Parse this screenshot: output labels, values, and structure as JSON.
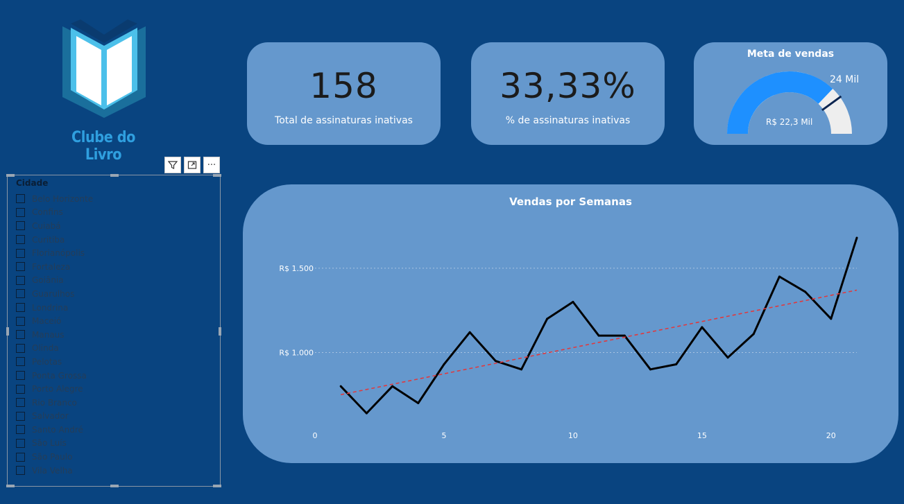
{
  "brand": {
    "name": "Clube do Livro",
    "logo_icon": "open-book-icon",
    "colors": {
      "dark": "#1a6f9c",
      "light": "#4cc0ea",
      "page": "#ffffff"
    }
  },
  "slicer": {
    "title": "Cidade",
    "toolbar": {
      "filter_icon": "filter-icon",
      "focus_icon": "focus-mode-icon",
      "more_icon": "more-options-icon",
      "more_label": "···"
    },
    "items": [
      "Belo Horizonte",
      "Confins",
      "Cuiabá",
      "Curitiba",
      "Florianópolis",
      "Fortaleza",
      "Goiânia",
      "Guarulhos",
      "Londrina",
      "Maceió",
      "Manaus",
      "Olinda",
      "Pelotas",
      "Ponta Grossa",
      "Porto Alegre",
      "Rio Branco",
      "Salvador",
      "Santo André",
      "São Luís",
      "São Paulo",
      "Vila Velha"
    ]
  },
  "kpi_inactive": {
    "value": "158",
    "label": "Total de assinaturas inativas"
  },
  "kpi_pct": {
    "value": "33,33%",
    "label": "% de assinaturas inativas"
  },
  "gauge": {
    "title": "Meta de vendas",
    "target_label": "24 Mil",
    "value_label": "R$ 22,3 Mil",
    "value": 22.3,
    "target": 24,
    "max": 30,
    "colors": {
      "fill": "#1e90ff",
      "track": "#eeeeee",
      "target": "#0b2550"
    }
  },
  "chart_data": {
    "type": "line",
    "title": "Vendas por Semanas",
    "xlabel": "",
    "ylabel": "",
    "x_ticks": [
      0,
      5,
      10,
      15,
      20
    ],
    "y_ticks": [
      1000,
      1500
    ],
    "y_tick_labels": [
      "R$ 1.000",
      "R$ 1.500"
    ],
    "xlim": [
      0,
      21
    ],
    "grid": true,
    "series": [
      {
        "type": "line",
        "color": "#000000",
        "x": [
          1,
          2,
          3,
          4,
          5,
          6,
          7,
          8,
          9,
          10,
          11,
          12,
          13,
          14,
          15,
          16,
          17,
          18,
          19,
          20,
          21
        ],
        "y": [
          800,
          640,
          800,
          700,
          930,
          1120,
          950,
          900,
          1200,
          1300,
          1100,
          1100,
          900,
          930,
          1150,
          970,
          1110,
          1450,
          1360,
          1200,
          1680
        ]
      },
      {
        "type": "trend",
        "color": "#e0393e",
        "x": [
          1,
          21
        ],
        "y": [
          750,
          1370
        ]
      }
    ]
  }
}
